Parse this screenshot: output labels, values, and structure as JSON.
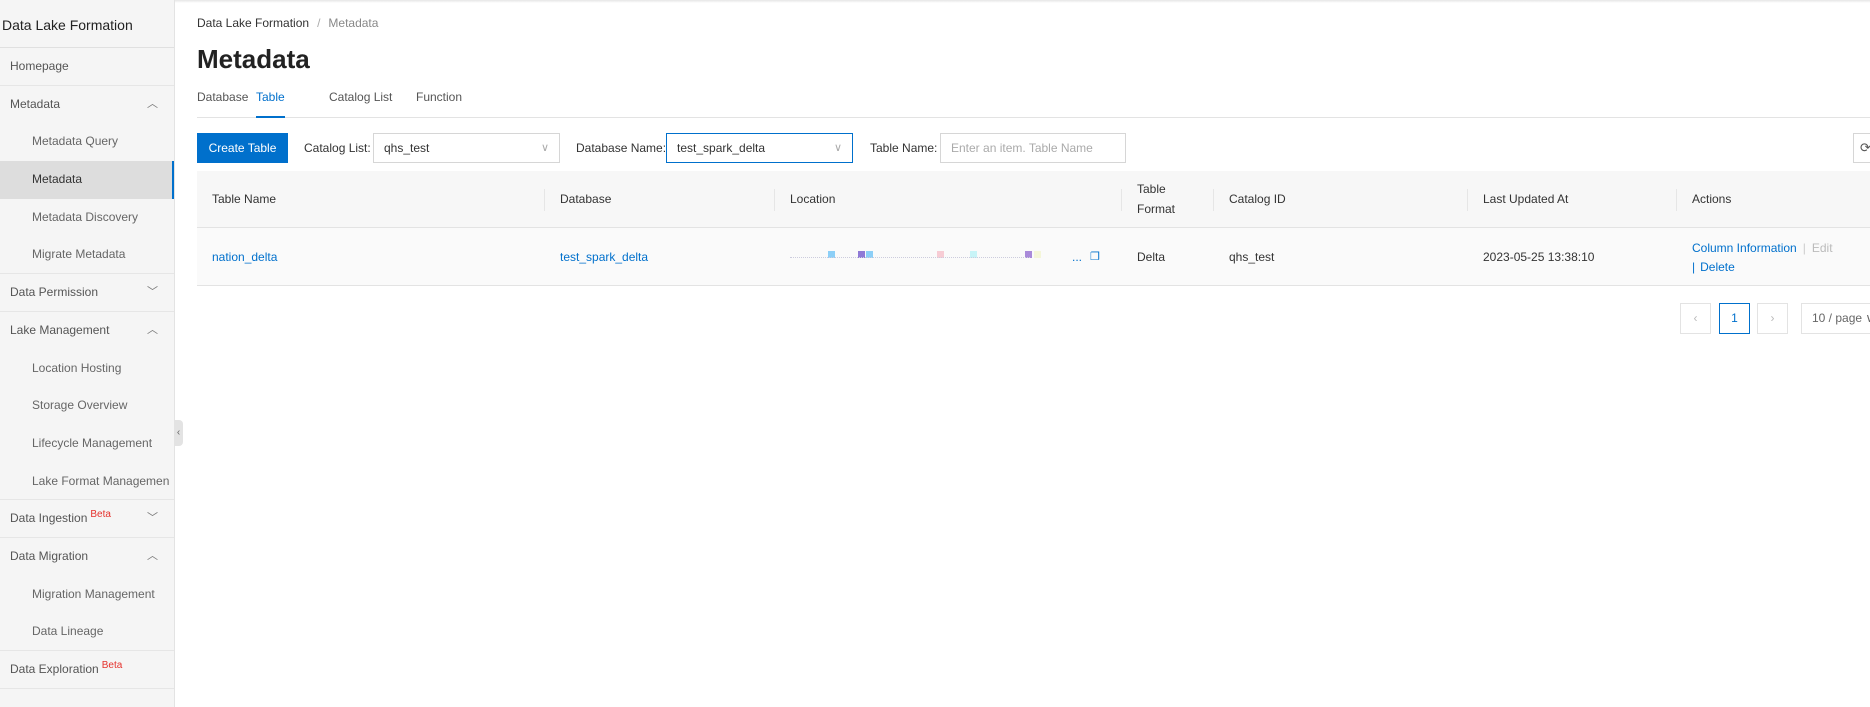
{
  "sidebar": {
    "title": "Data Lake Formation",
    "items": [
      {
        "label": "Homepage",
        "type": "group"
      },
      {
        "label": "Metadata",
        "type": "group-open",
        "chevron": "up"
      },
      {
        "label": "Metadata Query",
        "type": "sub"
      },
      {
        "label": "Metadata",
        "type": "sub",
        "selected": true
      },
      {
        "label": "Metadata Discovery",
        "type": "sub"
      },
      {
        "label": "Migrate Metadata",
        "type": "sub"
      },
      {
        "label": "Data Permission",
        "type": "group",
        "chevron": "down"
      },
      {
        "label": "Lake Management",
        "type": "group-open",
        "chevron": "up"
      },
      {
        "label": "Location Hosting",
        "type": "sub"
      },
      {
        "label": "Storage Overview",
        "type": "sub"
      },
      {
        "label": "Lifecycle Management",
        "type": "sub"
      },
      {
        "label": "Lake Format Managemen",
        "type": "sub"
      },
      {
        "label": "Data Ingestion",
        "type": "group",
        "chevron": "down",
        "badge": "Beta"
      },
      {
        "label": "Data Migration",
        "type": "group-open",
        "chevron": "up"
      },
      {
        "label": "Migration Management",
        "type": "sub"
      },
      {
        "label": "Data Lineage",
        "type": "sub"
      },
      {
        "label": "Data Exploration",
        "type": "group",
        "badge": "Beta"
      }
    ]
  },
  "breadcrumb": {
    "root": "Data Lake Formation",
    "current": "Metadata"
  },
  "page_title": "Metadata",
  "tabs": [
    {
      "label": "Database"
    },
    {
      "label": "Table",
      "active": true
    },
    {
      "label": "Catalog List"
    },
    {
      "label": "Function"
    }
  ],
  "toolbar": {
    "create_label": "Create Table",
    "catalog_label": "Catalog List:",
    "catalog_value": "qhs_test",
    "database_label": "Database Name:",
    "database_value": "test_spark_delta",
    "table_label": "Table Name:",
    "table_placeholder": "Enter an item. Table Name"
  },
  "table": {
    "columns": [
      "Table Name",
      "Database",
      "Location",
      "Table Format",
      "Catalog ID",
      "Last Updated At",
      "Actions"
    ],
    "rows": [
      {
        "table_name": "nation_delta",
        "database": "test_spark_delta",
        "location_suffix": "...",
        "format": "Delta",
        "catalog_id": "qhs_test",
        "updated": "2023-05-25 13:38:10",
        "actions": [
          "Column Information",
          "Edit",
          "Delete"
        ]
      }
    ]
  },
  "pagination": {
    "current": "1",
    "page_size": "10 / page"
  },
  "colors": {
    "accent": "#0070cc",
    "beta": "#e5322d"
  }
}
